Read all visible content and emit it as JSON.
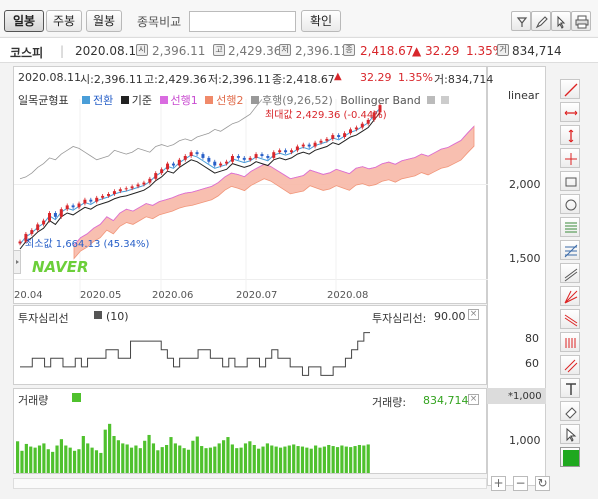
{
  "period_tabs": [
    {
      "label": "일봉",
      "active": true
    },
    {
      "label": "주봉",
      "active": false
    },
    {
      "label": "월봉",
      "active": false
    }
  ],
  "compare": {
    "label": "종목비교",
    "input_value": "",
    "confirm_label": "확인"
  },
  "info": {
    "name": "코스피",
    "date": "2020.08.11",
    "open_badge": "시",
    "open": "2,396.11",
    "high_badge": "고",
    "high": "2,429.36",
    "low_badge": "저",
    "low": "2,396.11",
    "close_badge": "종",
    "close": "2,418.67",
    "change": "▲ 32.29",
    "change_pct": "1.35%",
    "volume_badge": "거",
    "volume": "834,714"
  },
  "price_header": {
    "date": "2020.08.11",
    "open": "시:2,396.11",
    "high": "고:2,429.36",
    "low": "저:2,396.11",
    "close": "종:2,418.67",
    "arrow": "▲",
    "change": "32.29",
    "change_pct": "1.35%",
    "volume": "거:834,714"
  },
  "legend": {
    "title": "일목균형표",
    "items": [
      {
        "label": "전환",
        "color": "#4a9ed8"
      },
      {
        "label": "기준",
        "color": "#222222"
      },
      {
        "label": "선행1",
        "color": "#d96be0"
      },
      {
        "label": "선행2",
        "color": "#f08a6a"
      },
      {
        "label": "후행(9,26,52)",
        "color": "#999999"
      }
    ],
    "bollinger": "Bollinger Band",
    "scale": "linear"
  },
  "annotations": {
    "max": "최대값 2,429.36 (-0.44%)",
    "min": "최소값 1,664.13 (45.34%)"
  },
  "watermark": "NAVER",
  "x_labels": [
    "20.04",
    "2020.05",
    "2020.06",
    "2020.07",
    "2020.08"
  ],
  "price_axis": [
    "2,000",
    "1,500"
  ],
  "sentiment": {
    "title": "투자심리선",
    "param": "(10)",
    "value_label": "투자심리선:",
    "value": "90.00",
    "axis": [
      "80",
      "60"
    ]
  },
  "volume": {
    "title": "거래량",
    "value_label": "거래량:",
    "value": "834,714",
    "unit": "*1,000",
    "axis": [
      "1,000"
    ]
  },
  "colors": {
    "up": "#d8262b",
    "down": "#2860c8",
    "volume": "#4fc12d"
  },
  "chart_data": {
    "type": "line",
    "title": "코스피",
    "price_range": [
      1450,
      2450
    ],
    "close_series": [
      1700,
      1740,
      1760,
      1790,
      1810,
      1850,
      1830,
      1870,
      1890,
      1880,
      1900,
      1920,
      1910,
      1930,
      1940,
      1950,
      1965,
      1975,
      1980,
      1990,
      2000,
      2010,
      2030,
      2060,
      2080,
      2110,
      2100,
      2130,
      2150,
      2170,
      2160,
      2140,
      2120,
      2100,
      2110,
      2120,
      2150,
      2140,
      2130,
      2140,
      2160,
      2150,
      2140,
      2170,
      2180,
      2170,
      2180,
      2200,
      2210,
      2200,
      2220,
      2230,
      2240,
      2260,
      2250,
      2270,
      2290,
      2300,
      2320,
      2340,
      2380,
      2418
    ],
    "sentiment_series": [
      50,
      50,
      60,
      60,
      50,
      60,
      60,
      50,
      50,
      60,
      50,
      60,
      60,
      60,
      70,
      70,
      60,
      60,
      80,
      80,
      80,
      80,
      80,
      70,
      60,
      50,
      60,
      60,
      60,
      70,
      70,
      60,
      60,
      50,
      60,
      50,
      50,
      60,
      60,
      50,
      60,
      70,
      60,
      60,
      50,
      50,
      40,
      50,
      50,
      40,
      40,
      50,
      50,
      60,
      70,
      80,
      90,
      90
    ],
    "sentiment_range": [
      30,
      100
    ],
    "volume_series": [
      600,
      420,
      550,
      500,
      480,
      520,
      560,
      450,
      400,
      520,
      640,
      520,
      480,
      420,
      450,
      700,
      560,
      480,
      430,
      380,
      820,
      930,
      700,
      620,
      560,
      540,
      480,
      520,
      470,
      610,
      720,
      560,
      430,
      490,
      530,
      680,
      560,
      520,
      470,
      440,
      610,
      690,
      510,
      470,
      480,
      500,
      560,
      620,
      680,
      540,
      470,
      480,
      560,
      600,
      530,
      460,
      500,
      560,
      520,
      500,
      480,
      500,
      520,
      540,
      510,
      500,
      480,
      460,
      520,
      480,
      500,
      530,
      510,
      490,
      520,
      500,
      490,
      510,
      530,
      520,
      540
    ],
    "volume_range": [
      0,
      1400
    ]
  }
}
